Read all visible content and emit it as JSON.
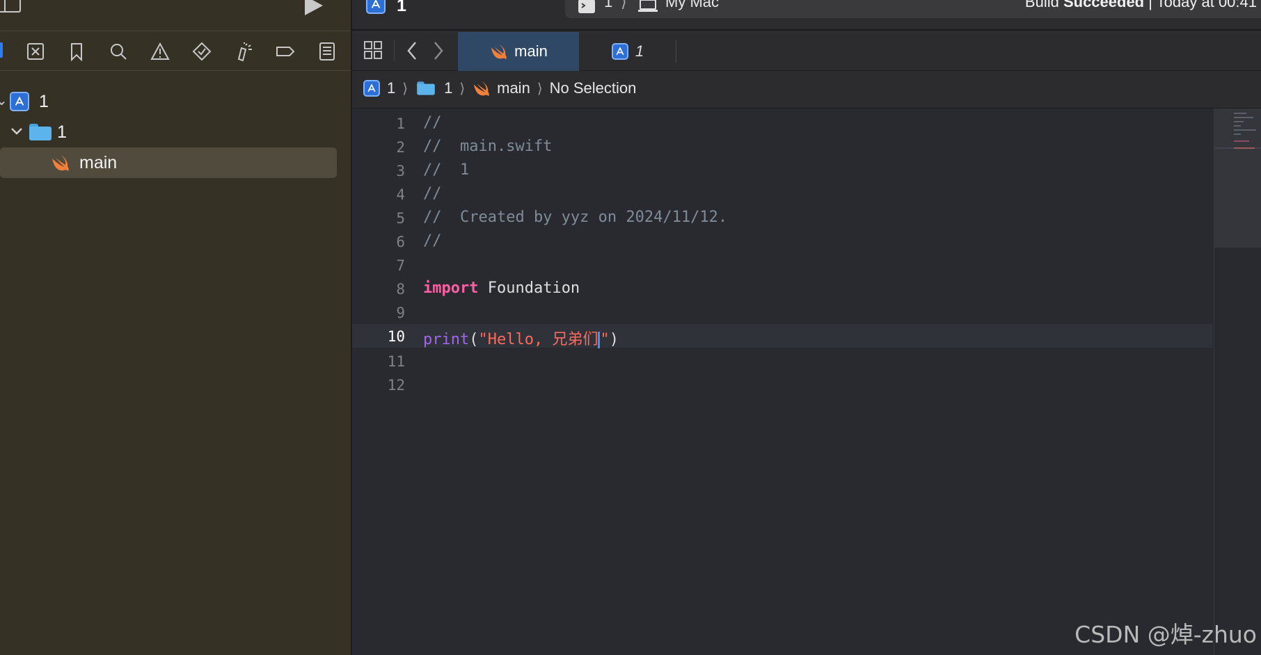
{
  "toolbar": {
    "scheme_name": "1",
    "destination_project": "1",
    "destination_device": "My Mac",
    "status_prefix": "Build ",
    "status_strong": "Succeeded",
    "status_suffix": " | Today at 00:41"
  },
  "navigator_tabs": [
    {
      "icon": "folder-icon",
      "active": true
    },
    {
      "icon": "source-control-icon"
    },
    {
      "icon": "bookmark-icon"
    },
    {
      "icon": "search-icon"
    },
    {
      "icon": "warning-icon"
    },
    {
      "icon": "test-icon"
    },
    {
      "icon": "debug-icon"
    },
    {
      "icon": "breakpoint-icon"
    },
    {
      "icon": "report-icon"
    }
  ],
  "project_tree": {
    "project": "1",
    "group": "1",
    "file": "main"
  },
  "tabs": [
    {
      "label": "main",
      "icon": "swift-icon",
      "active": true
    },
    {
      "label": "1",
      "icon": "app-icon",
      "active": false
    }
  ],
  "jumpbar": {
    "project": "1",
    "group": "1",
    "file": "main",
    "selection": "No Selection"
  },
  "code": {
    "current_line": 10,
    "lines": [
      {
        "n": "1",
        "comment": "//"
      },
      {
        "n": "2",
        "comment": "//  main.swift"
      },
      {
        "n": "3",
        "comment": "//  1"
      },
      {
        "n": "4",
        "comment": "//"
      },
      {
        "n": "5",
        "comment": "//  Created by yyz on 2024/11/12."
      },
      {
        "n": "6",
        "comment": "//"
      },
      {
        "n": "7"
      },
      {
        "n": "8",
        "keyword": "import",
        "plain": " Foundation"
      },
      {
        "n": "9"
      },
      {
        "n": "10",
        "func": "print",
        "open": "(",
        "string": "\"Hello, 兄弟们",
        "string_end": "\"",
        "close": ")"
      },
      {
        "n": "11"
      },
      {
        "n": "12"
      }
    ]
  },
  "watermark": "CSDN @焯-zhuo",
  "colors": {
    "sidebar_bg": "#363125",
    "editor_bg": "#292a30",
    "comment": "#7f8c98",
    "keyword": "#fc5fa3",
    "function": "#a167e6",
    "string": "#fc6a5d",
    "active_tab": "#2f4866"
  }
}
